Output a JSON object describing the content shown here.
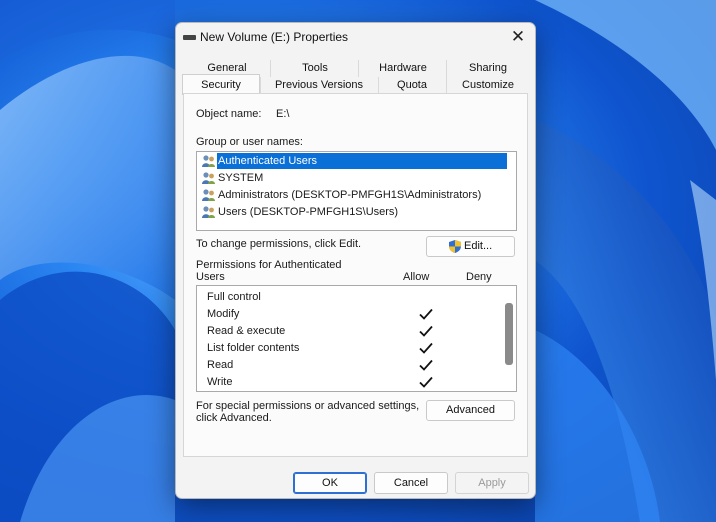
{
  "window": {
    "title": "New Volume (E:) Properties"
  },
  "tabs": {
    "back_row": [
      "General",
      "Tools",
      "Hardware",
      "Sharing"
    ],
    "front_row": [
      "Security",
      "Previous Versions",
      "Quota",
      "Customize"
    ],
    "active": "Security"
  },
  "security": {
    "object_name_label": "Object name:",
    "object_name_value": "E:\\",
    "group_label": "Group or user names:",
    "groups": [
      "Authenticated Users",
      "SYSTEM",
      "Administrators (DESKTOP-PMFGH1S\\Administrators)",
      "Users (DESKTOP-PMFGH1S\\Users)"
    ],
    "selected_group": "Authenticated Users",
    "change_hint": "To change permissions, click Edit.",
    "edit_label": "Edit...",
    "perms_label_line1": "Permissions for Authenticated",
    "perms_label_line2": "Users",
    "allow_header": "Allow",
    "deny_header": "Deny",
    "permissions": [
      {
        "name": "Full control",
        "allow": false,
        "deny": false
      },
      {
        "name": "Modify",
        "allow": true,
        "deny": false
      },
      {
        "name": "Read & execute",
        "allow": true,
        "deny": false
      },
      {
        "name": "List folder contents",
        "allow": true,
        "deny": false
      },
      {
        "name": "Read",
        "allow": true,
        "deny": false
      },
      {
        "name": "Write",
        "allow": true,
        "deny": false
      }
    ],
    "advanced_hint_line1": "For special permissions or advanced settings,",
    "advanced_hint_line2": "click Advanced.",
    "advanced_label": "Advanced"
  },
  "footer": {
    "ok": "OK",
    "cancel": "Cancel",
    "apply": "Apply",
    "apply_enabled": false
  },
  "colors": {
    "selection": "#0a6fd7",
    "accent": "#2d6fd2"
  },
  "icons": {
    "title": "drive-icon",
    "group": "users-group-icon",
    "edit": "uac-shield-icon",
    "check": "checkmark-icon",
    "close": "close-icon"
  }
}
